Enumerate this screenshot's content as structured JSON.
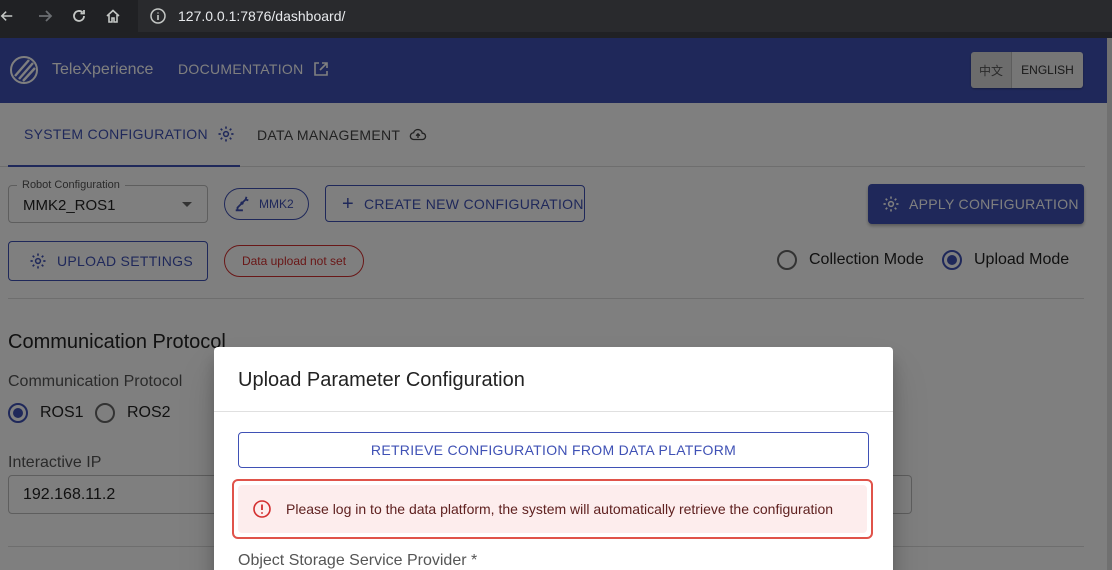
{
  "browser": {
    "url": "127.0.0.1:7876/dashboard/"
  },
  "header": {
    "brand": "TeleXperience",
    "docs_label": "DOCUMENTATION",
    "lang_zh": "中文",
    "lang_en": "ENGLISH",
    "color": "#3f51b5"
  },
  "tabs": [
    {
      "label": "SYSTEM CONFIGURATION",
      "icon": "gear-icon",
      "active": true
    },
    {
      "label": "DATA MANAGEMENT",
      "icon": "cloud-upload-icon",
      "active": false
    }
  ],
  "config": {
    "robot_config_label": "Robot Configuration",
    "robot_config_value": "MMK2_ROS1",
    "robot_chip": "MMK2",
    "create_button": "CREATE NEW CONFIGURATION",
    "apply_button": "APPLY CONFIGURATION",
    "upload_settings_button": "UPLOAD SETTINGS",
    "upload_status": "Data upload not set",
    "modes": [
      {
        "label": "Collection Mode",
        "checked": false
      },
      {
        "label": "Upload Mode",
        "checked": true
      }
    ]
  },
  "protocol": {
    "section_title": "Communication Protocol",
    "sub_label": "Communication Protocol",
    "options": [
      {
        "label": "ROS1",
        "checked": true
      },
      {
        "label": "ROS2",
        "checked": false
      }
    ],
    "ip_label": "Interactive IP",
    "ip_value": "192.168.11.2"
  },
  "modal": {
    "title": "Upload Parameter Configuration",
    "retrieve_button": "RETRIEVE CONFIGURATION FROM DATA PLATFORM",
    "alert_text": "Please log in to the data platform, the system will automatically retrieve the configuration",
    "oss_label": "Object Storage Service Provider *"
  }
}
